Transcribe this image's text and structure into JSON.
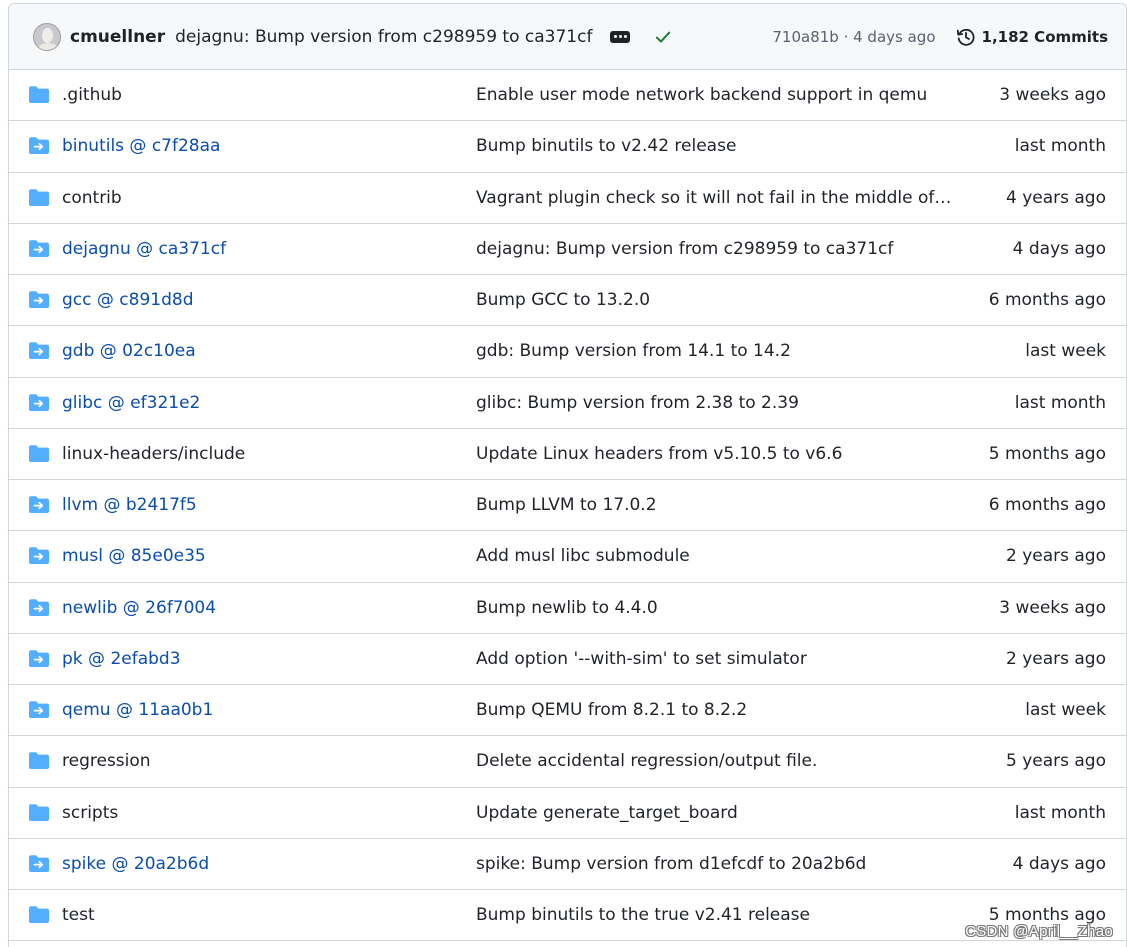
{
  "latest_commit": {
    "author": "cmuellner",
    "message": "dejagnu: Bump version from c298959 to ca371cf",
    "sha_and_time": "710a81b · 4 days ago",
    "commits_label": "1,182 Commits",
    "status_color": "#1a7f37"
  },
  "colors": {
    "folder": "#54aeff",
    "submodule": "#54aeff",
    "link": "#0b4dab",
    "border": "#d0d7de",
    "header_bg": "#f6f8fa"
  },
  "files": [
    {
      "type": "folder",
      "name": ".github",
      "message": "Enable user mode network backend support in qemu",
      "age": "3 weeks ago"
    },
    {
      "type": "submodule",
      "name": "binutils @ c7f28aa",
      "message": "Bump binutils to v2.42 release",
      "age": "last month"
    },
    {
      "type": "folder",
      "name": "contrib",
      "message": "Vagrant plugin check so it will not fail in the middle of pr…",
      "age": "4 years ago"
    },
    {
      "type": "submodule",
      "name": "dejagnu @ ca371cf",
      "message": "dejagnu: Bump version from c298959 to ca371cf",
      "age": "4 days ago"
    },
    {
      "type": "submodule",
      "name": "gcc @ c891d8d",
      "message": "Bump GCC to 13.2.0",
      "age": "6 months ago"
    },
    {
      "type": "submodule",
      "name": "gdb @ 02c10ea",
      "message": "gdb: Bump version from 14.1 to 14.2",
      "age": "last week"
    },
    {
      "type": "submodule",
      "name": "glibc @ ef321e2",
      "message": "glibc: Bump version from 2.38 to 2.39",
      "age": "last month"
    },
    {
      "type": "folder",
      "name": "linux-headers/include",
      "message": "Update Linux headers from v5.10.5 to v6.6",
      "age": "5 months ago"
    },
    {
      "type": "submodule",
      "name": "llvm @ b2417f5",
      "message": "Bump LLVM to 17.0.2",
      "age": "6 months ago"
    },
    {
      "type": "submodule",
      "name": "musl @ 85e0e35",
      "message": "Add musl libc submodule",
      "age": "2 years ago"
    },
    {
      "type": "submodule",
      "name": "newlib @ 26f7004",
      "message": "Bump newlib to 4.4.0",
      "age": "3 weeks ago"
    },
    {
      "type": "submodule",
      "name": "pk @ 2efabd3",
      "message": "Add option '--with-sim' to set simulator",
      "age": "2 years ago"
    },
    {
      "type": "submodule",
      "name": "qemu @ 11aa0b1",
      "message": "Bump QEMU from 8.2.1 to 8.2.2",
      "age": "last week"
    },
    {
      "type": "folder",
      "name": "regression",
      "message": "Delete accidental regression/output file.",
      "age": "5 years ago"
    },
    {
      "type": "folder",
      "name": "scripts",
      "message": "Update generate_target_board",
      "age": "last month"
    },
    {
      "type": "submodule",
      "name": "spike @ 20a2b6d",
      "message": "spike: Bump version from d1efcdf to 20a2b6d",
      "age": "4 days ago"
    },
    {
      "type": "folder",
      "name": "test",
      "message": "Bump binutils to the true v2.41 release",
      "age": "5 months ago"
    }
  ],
  "watermark": "CSDN @April__Zhao"
}
